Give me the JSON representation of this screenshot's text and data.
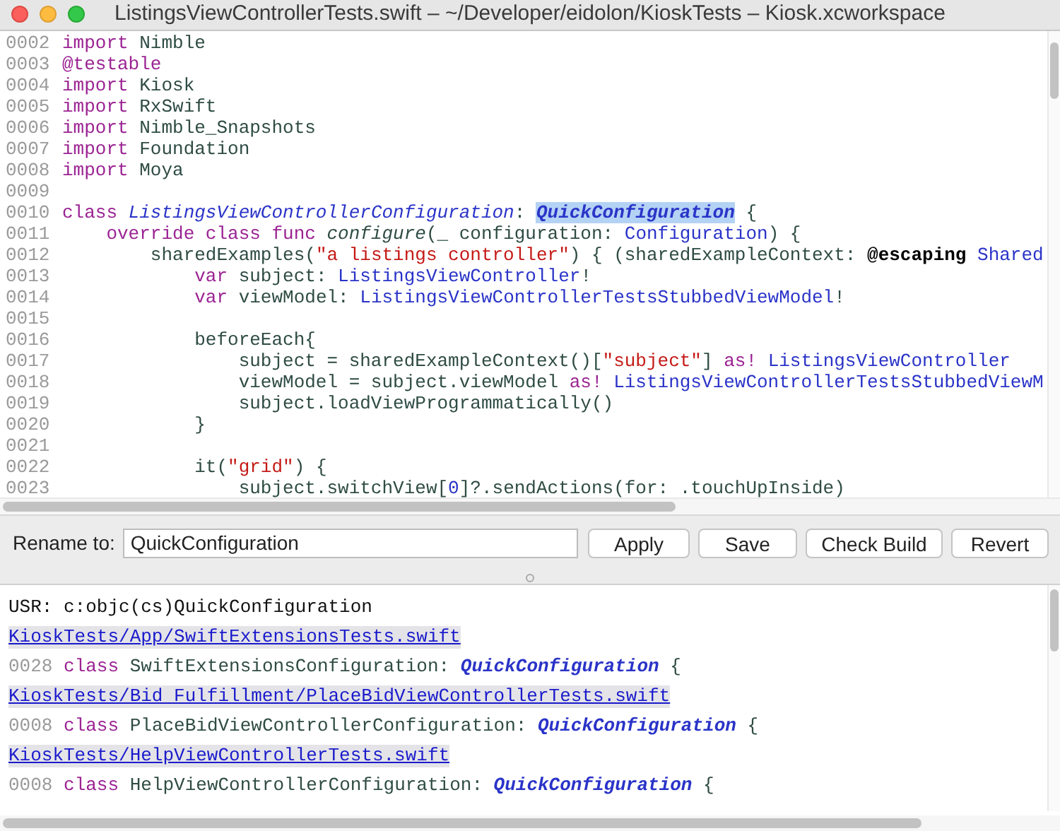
{
  "window": {
    "title": "ListingsViewControllerTests.swift – ~/Developer/eidolon/KioskTests – Kiosk.xcworkspace"
  },
  "editor": {
    "lines": [
      {
        "number": "0002",
        "tokens": [
          {
            "text": "import",
            "kind": "kw"
          },
          {
            "text": " Nimble",
            "kind": "plain"
          }
        ]
      },
      {
        "number": "0003",
        "tokens": [
          {
            "text": "@testable",
            "kind": "kw"
          }
        ]
      },
      {
        "number": "0004",
        "tokens": [
          {
            "text": "import",
            "kind": "kw"
          },
          {
            "text": " Kiosk",
            "kind": "plain"
          }
        ]
      },
      {
        "number": "0005",
        "tokens": [
          {
            "text": "import",
            "kind": "kw"
          },
          {
            "text": " RxSwift",
            "kind": "plain"
          }
        ]
      },
      {
        "number": "0006",
        "tokens": [
          {
            "text": "import",
            "kind": "kw"
          },
          {
            "text": " Nimble_Snapshots",
            "kind": "plain"
          }
        ]
      },
      {
        "number": "0007",
        "tokens": [
          {
            "text": "import",
            "kind": "kw"
          },
          {
            "text": " Foundation",
            "kind": "plain"
          }
        ]
      },
      {
        "number": "0008",
        "tokens": [
          {
            "text": "import",
            "kind": "kw"
          },
          {
            "text": " Moya",
            "kind": "plain"
          }
        ]
      },
      {
        "number": "0009"
      },
      {
        "number": "0010",
        "tokens": [
          {
            "text": "class ",
            "kind": "kw"
          },
          {
            "text": "ListingsViewControllerConfiguration",
            "kind": "decl"
          },
          {
            "text": ": ",
            "kind": "plain"
          },
          {
            "text": "QuickConfiguration",
            "kind": "match"
          },
          {
            "text": " {",
            "kind": "plain"
          }
        ]
      },
      {
        "number": "0011",
        "tokens": [
          {
            "text": "    override class func ",
            "kind": "kw"
          },
          {
            "text": "configure",
            "kind": "fn"
          },
          {
            "text": "(_ configuration: ",
            "kind": "plain"
          },
          {
            "text": "Configuration",
            "kind": "type"
          },
          {
            "text": ") {",
            "kind": "plain"
          }
        ]
      },
      {
        "number": "0012",
        "tokens": [
          {
            "text": "        sharedExamples(",
            "kind": "plain"
          },
          {
            "text": "\"a listings controller\"",
            "kind": "str"
          },
          {
            "text": ") { (sharedExampleContext: ",
            "kind": "plain"
          },
          {
            "text": "@escaping ",
            "kind": "attr"
          },
          {
            "text": "Shared",
            "kind": "type"
          }
        ]
      },
      {
        "number": "0013",
        "tokens": [
          {
            "text": "            var",
            "kind": "kw"
          },
          {
            "text": " subject: ",
            "kind": "plain"
          },
          {
            "text": "ListingsViewController",
            "kind": "type"
          },
          {
            "text": "!",
            "kind": "plain"
          }
        ]
      },
      {
        "number": "0014",
        "tokens": [
          {
            "text": "            var",
            "kind": "kw"
          },
          {
            "text": " viewModel: ",
            "kind": "plain"
          },
          {
            "text": "ListingsViewControllerTestsStubbedViewModel",
            "kind": "type"
          },
          {
            "text": "!",
            "kind": "plain"
          }
        ]
      },
      {
        "number": "0015"
      },
      {
        "number": "0016",
        "tokens": [
          {
            "text": "            beforeEach{",
            "kind": "plain"
          }
        ]
      },
      {
        "number": "0017",
        "tokens": [
          {
            "text": "                subject = sharedExampleContext()[",
            "kind": "plain"
          },
          {
            "text": "\"subject\"",
            "kind": "str"
          },
          {
            "text": "] ",
            "kind": "plain"
          },
          {
            "text": "as! ",
            "kind": "kw"
          },
          {
            "text": "ListingsViewController",
            "kind": "type"
          }
        ]
      },
      {
        "number": "0018",
        "tokens": [
          {
            "text": "                viewModel = subject.viewModel ",
            "kind": "plain"
          },
          {
            "text": "as! ",
            "kind": "kw"
          },
          {
            "text": "ListingsViewControllerTestsStubbedViewM",
            "kind": "type"
          }
        ]
      },
      {
        "number": "0019",
        "tokens": [
          {
            "text": "                subject.loadViewProgrammatically()",
            "kind": "plain"
          }
        ]
      },
      {
        "number": "0020",
        "tokens": [
          {
            "text": "            }",
            "kind": "plain"
          }
        ]
      },
      {
        "number": "0021"
      },
      {
        "number": "0022",
        "tokens": [
          {
            "text": "            it(",
            "kind": "plain"
          },
          {
            "text": "\"grid\"",
            "kind": "str"
          },
          {
            "text": ") {",
            "kind": "plain"
          }
        ]
      },
      {
        "number": "0023",
        "tokens": [
          {
            "text": "                subject.switchView[",
            "kind": "plain"
          },
          {
            "text": "0",
            "kind": "num"
          },
          {
            "text": "]?.sendActions(for: .touchUpInside)",
            "kind": "plain"
          }
        ]
      }
    ]
  },
  "rename_bar": {
    "label": "Rename to:",
    "value": "QuickConfiguration",
    "buttons": [
      "Apply",
      "Save",
      "Check Build",
      "Revert"
    ]
  },
  "results": [
    {
      "kind": "usr",
      "text": "USR: c:objc(cs)QuickConfiguration"
    },
    {
      "kind": "link",
      "text": "KioskTests/App/SwiftExtensionsTests.swift"
    },
    {
      "kind": "code",
      "number": "0028",
      "tokens": [
        {
          "text": "class",
          "kind": "kw"
        },
        {
          "text": " SwiftExtensionsConfiguration: ",
          "kind": "plain"
        },
        {
          "text": "QuickConfiguration",
          "kind": "ref"
        },
        {
          "text": " {",
          "kind": "plain"
        }
      ]
    },
    {
      "kind": "link",
      "text": "KioskTests/Bid Fulfillment/PlaceBidViewControllerTests.swift"
    },
    {
      "kind": "code",
      "number": "0008",
      "tokens": [
        {
          "text": "class",
          "kind": "kw"
        },
        {
          "text": " PlaceBidViewControllerConfiguration: ",
          "kind": "plain"
        },
        {
          "text": "QuickConfiguration",
          "kind": "ref"
        },
        {
          "text": " {",
          "kind": "plain"
        }
      ]
    },
    {
      "kind": "link",
      "text": "KioskTests/HelpViewControllerTests.swift"
    },
    {
      "kind": "code",
      "number": "0008",
      "tokens": [
        {
          "text": "class",
          "kind": "kw"
        },
        {
          "text": " HelpViewControllerConfiguration: ",
          "kind": "plain"
        },
        {
          "text": "QuickConfiguration",
          "kind": "ref"
        },
        {
          "text": " {",
          "kind": "plain"
        }
      ]
    }
  ]
}
